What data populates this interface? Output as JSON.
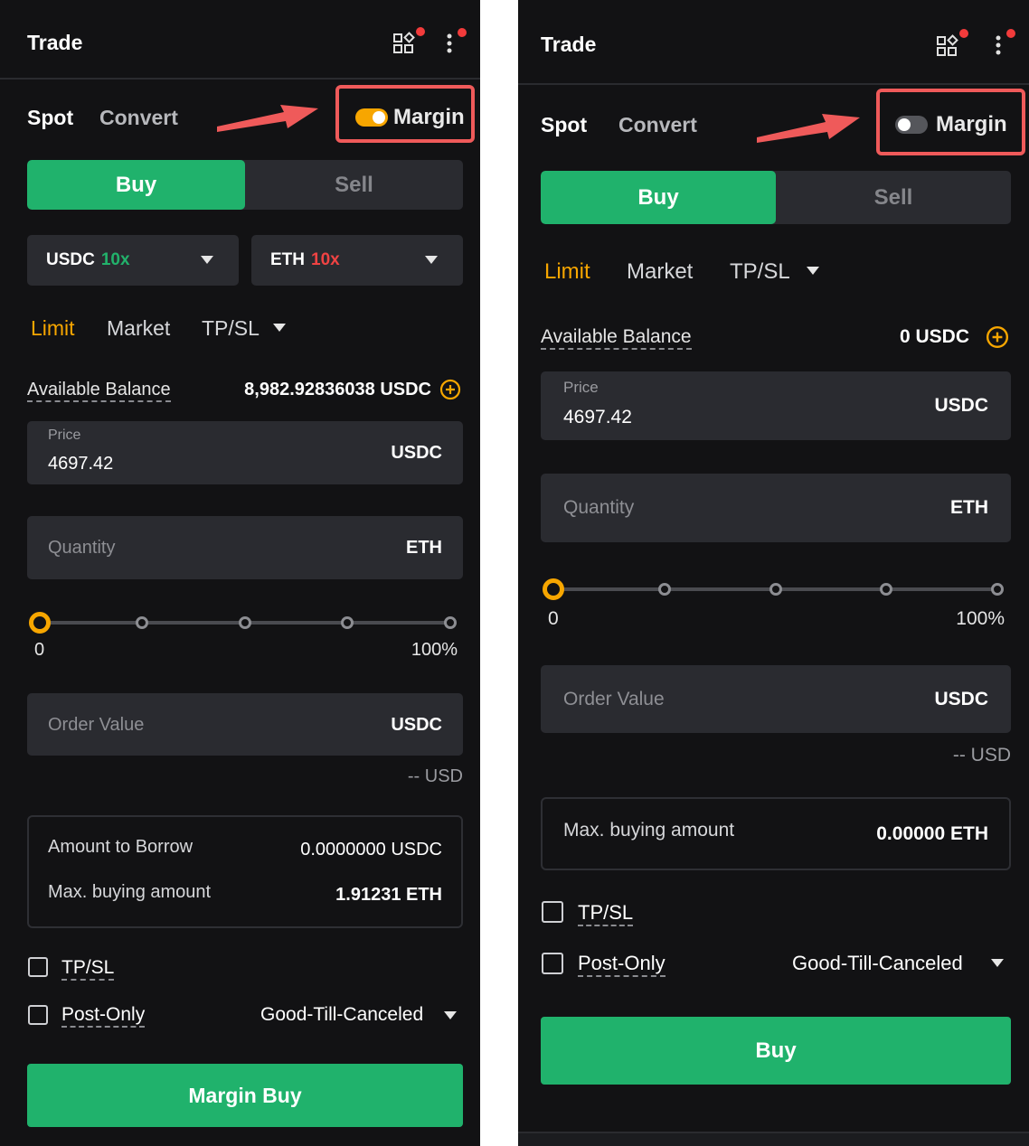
{
  "left_panel": {
    "header": {
      "title": "Trade"
    },
    "tabs": {
      "spot": "Spot",
      "convert": "Convert"
    },
    "margin_toggle": {
      "label": "Margin",
      "state": "on"
    },
    "side": {
      "buy": "Buy",
      "sell": "Sell"
    },
    "leverage": {
      "quote": {
        "asset": "USDC",
        "value": "10x",
        "color": "#22b26b"
      },
      "base": {
        "asset": "ETH",
        "value": "10x",
        "color": "#f04343"
      }
    },
    "order_types": {
      "limit": "Limit",
      "market": "Market",
      "tpsl": "TP/SL"
    },
    "balance": {
      "label": "Available Balance",
      "value": "8,982.92836038 USDC"
    },
    "price": {
      "label": "Price",
      "value": "4697.42",
      "unit": "USDC"
    },
    "quantity": {
      "placeholder": "Quantity",
      "unit": "ETH"
    },
    "slider": {
      "min": "0",
      "max": "100%",
      "value_percent": 0
    },
    "order_value": {
      "placeholder": "Order Value",
      "unit": "USDC",
      "usd": "-- USD"
    },
    "borrow_box": {
      "borrow_label": "Amount to Borrow",
      "borrow_value": "0.0000000 USDC",
      "max_label": "Max. buying amount",
      "max_value": "1.91231 ETH"
    },
    "options": {
      "tpsl": "TP/SL",
      "post_only": "Post-Only",
      "tif": "Good-Till-Canceled"
    },
    "submit": "Margin Buy"
  },
  "right_panel": {
    "header": {
      "title": "Trade"
    },
    "tabs": {
      "spot": "Spot",
      "convert": "Convert"
    },
    "margin_toggle": {
      "label": "Margin",
      "state": "off"
    },
    "side": {
      "buy": "Buy",
      "sell": "Sell"
    },
    "order_types": {
      "limit": "Limit",
      "market": "Market",
      "tpsl": "TP/SL"
    },
    "balance": {
      "label": "Available Balance",
      "value": "0 USDC"
    },
    "price": {
      "label": "Price",
      "value": "4697.42",
      "unit": "USDC"
    },
    "quantity": {
      "placeholder": "Quantity",
      "unit": "ETH"
    },
    "slider": {
      "min": "0",
      "max": "100%",
      "value_percent": 0
    },
    "order_value": {
      "placeholder": "Order Value",
      "unit": "USDC",
      "usd": "-- USD"
    },
    "max_box": {
      "max_label": "Max. buying amount",
      "max_value": "0.00000 ETH"
    },
    "options": {
      "tpsl": "TP/SL",
      "post_only": "Post-Only",
      "tif": "Good-Till-Canceled"
    },
    "submit": "Buy"
  },
  "colors": {
    "accent_green": "#20b26c",
    "accent_orange": "#f7a600",
    "annotation_red": "#ef5a5a",
    "panel_bg": "#121214",
    "field_bg": "#2a2b30"
  },
  "icons": [
    "grid-apps-icon",
    "more-vertical-icon",
    "notification-dot-icon",
    "chevron-down-icon",
    "plus-circle-icon",
    "annotation-arrow-icon",
    "checkbox-icon"
  ]
}
